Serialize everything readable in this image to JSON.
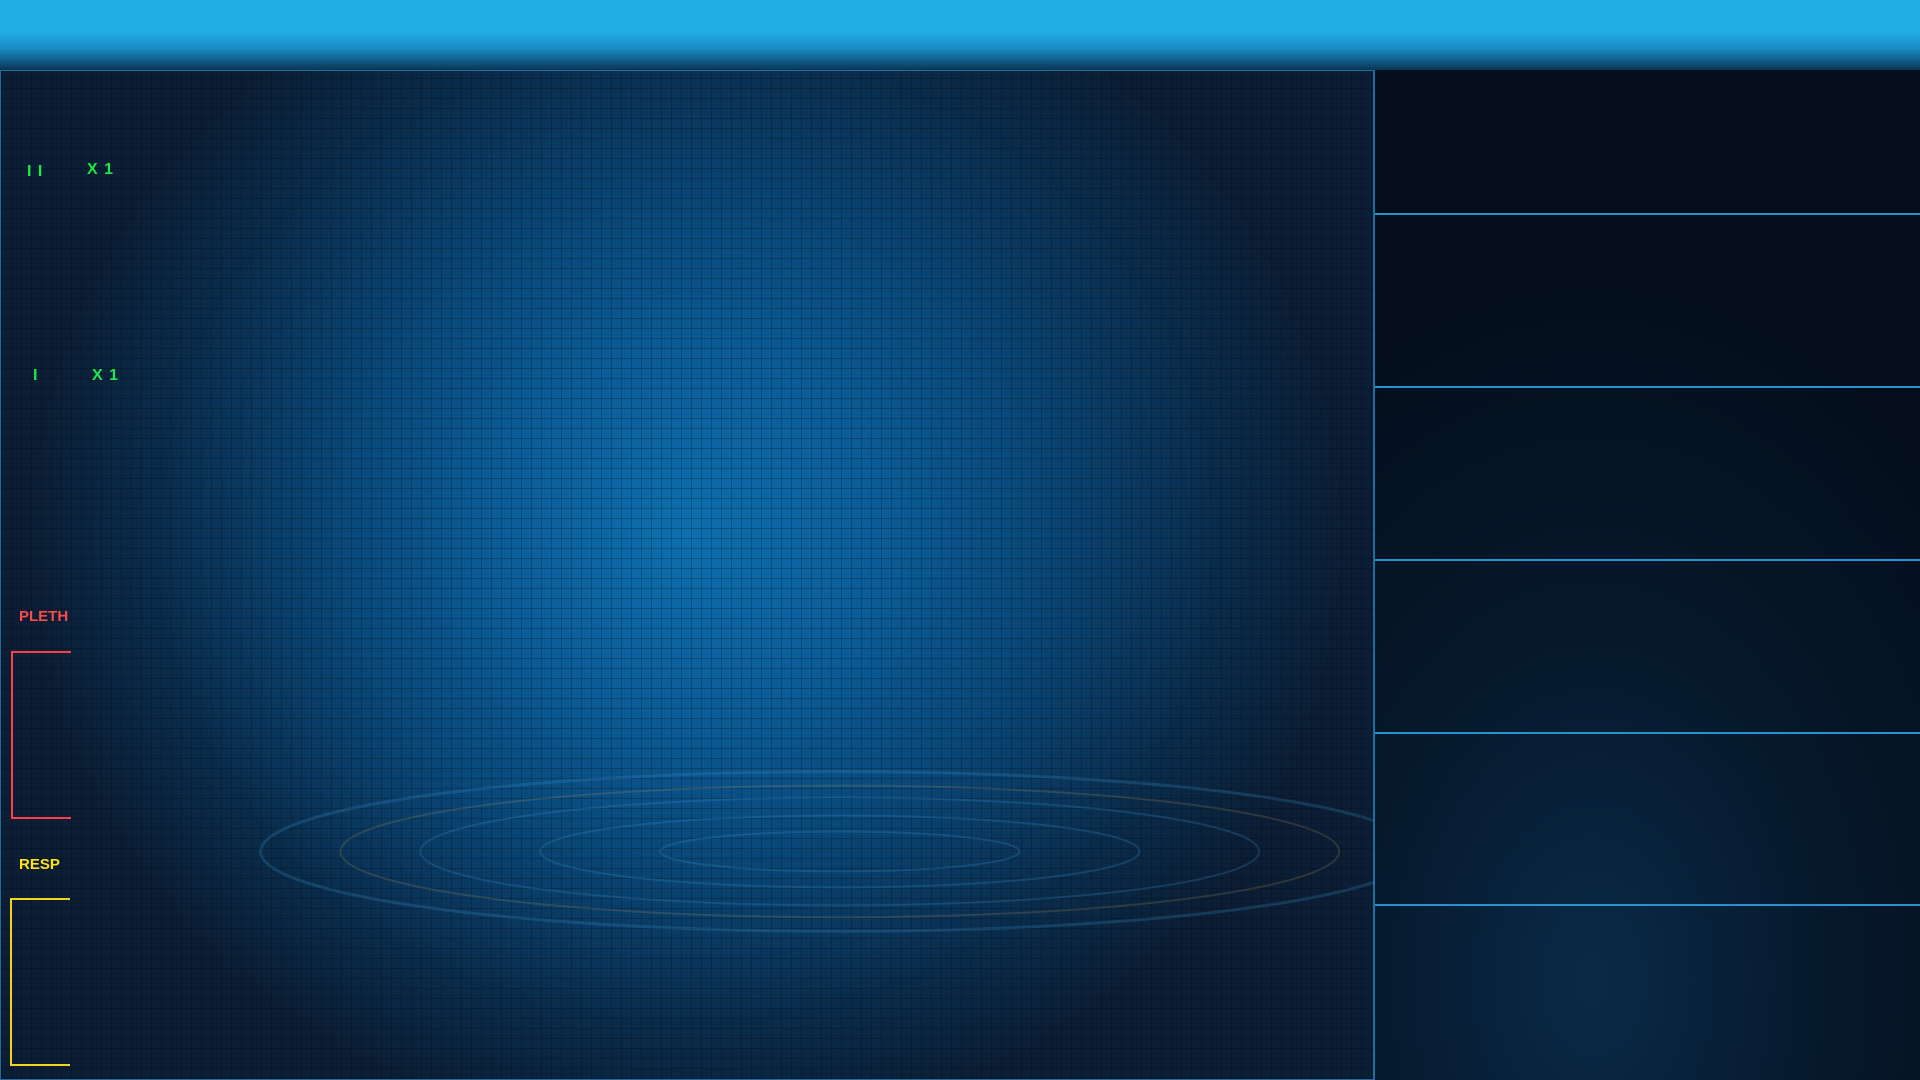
{
  "waveforms": {
    "ecg_lead_ii": {
      "lead": "I I",
      "gain": "X 1",
      "color": "#1ee84a"
    },
    "ecg_lead_i": {
      "lead": "I",
      "gain": "X 1",
      "color": "#1ee84a"
    },
    "pleth": {
      "label": "PLETH",
      "color": "#ff4a4a"
    },
    "resp": {
      "label": "RESP",
      "color": "#ffe21a"
    }
  },
  "parameter_panels": [
    {
      "name": "panel-1"
    },
    {
      "name": "panel-2"
    },
    {
      "name": "panel-3"
    },
    {
      "name": "panel-4"
    },
    {
      "name": "panel-5"
    },
    {
      "name": "panel-6"
    }
  ],
  "colors": {
    "header": "#20aee5",
    "grid_bg": "#0b5c97",
    "panel_border": "#2593cf"
  }
}
